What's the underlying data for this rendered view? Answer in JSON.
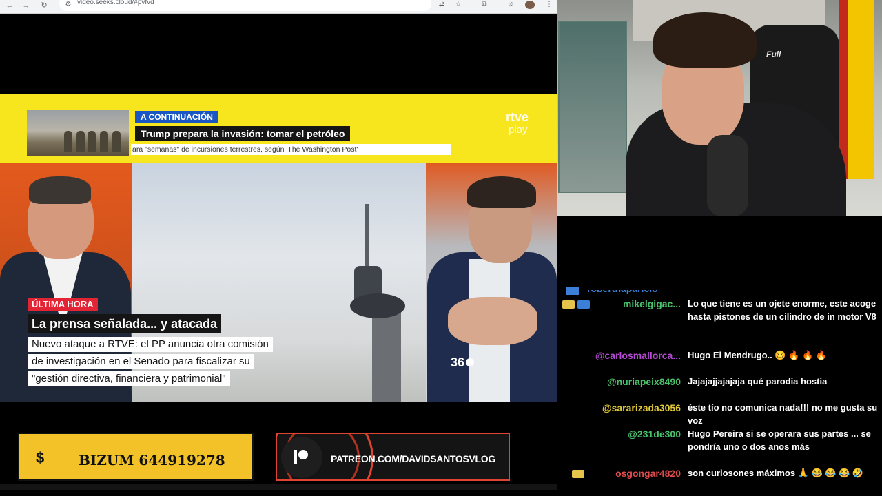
{
  "browser": {
    "url": "video.seeks.cloud/#pvfvd"
  },
  "video": {
    "next_label": "A CONTINUACIÓN",
    "next_title": "Trump prepara la invasión: tomar el petróleo",
    "next_sub": "ara \"semanas\" de incursiones terrestres, según 'The Washington Post'",
    "channel_logo": "rtve",
    "channel_logo_sub": "play",
    "breaking_label": "ÚLTIMA HORA",
    "headline": "La prensa señalada... y atacada",
    "body_lines": [
      "Nuevo ataque a RTVE: el PP anuncia otra comisión",
      "de investigación en el Senado para fiscalizar su",
      "\"gestión directiva, financiera y patrimonial\""
    ],
    "corner_logo": "36"
  },
  "banners": {
    "bizum_symbol": "$",
    "bizum_text": "BIZUM 644919278",
    "patreon_text": "PATREON.COM/DAVIDSANTOSVLOG"
  },
  "webcam": {
    "chair_brand": "Full"
  },
  "chat": {
    "partial_user": "robertnaparicio",
    "messages": [
      {
        "user": "mikelgigac...",
        "user_color": "#49c26b",
        "text": "Lo que tiene es un ojete enorme, este acoge hasta pistones de un cilindro de in motor V8"
      },
      {
        "user": "@carlosmallorca...",
        "user_color": "#b34ad1",
        "text": "Hugo El Mendrugo.. 🥴 🔥 🔥 🔥"
      },
      {
        "user": "@nuriapeix8490",
        "user_color": "#49c26b",
        "text": "Jajajajjajajaja qué parodia hostia"
      },
      {
        "user": "@sararizada3056",
        "user_color": "#e0c93a",
        "text": "éste tío no comunica nada!!! no me gusta su voz"
      },
      {
        "user": "@231de300",
        "user_color": "#49c26b",
        "text": "Hugo Pereira si se operara sus partes ... se pondría uno o dos anos más"
      },
      {
        "user": "osgongar4820",
        "user_color": "#e04b4b",
        "text": "son curiosones máximos 🙏 😂 😂 😂 🤣"
      }
    ]
  }
}
